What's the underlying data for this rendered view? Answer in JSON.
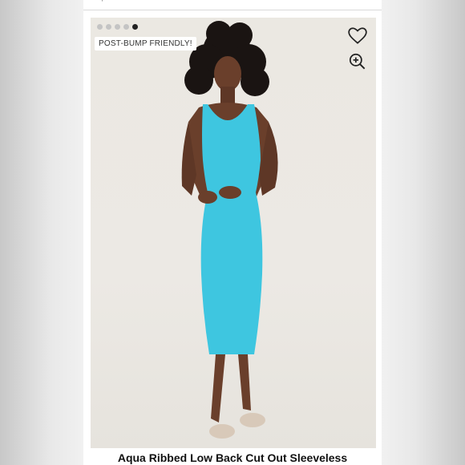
{
  "top_bar": {
    "partial_text": "… , … …"
  },
  "gallery": {
    "dots": [
      false,
      false,
      false,
      false,
      true
    ],
    "badge": "POST-BUMP FRIENDLY!",
    "favorite_icon": "heart-icon",
    "zoom_icon": "zoom-in-icon",
    "dress_color": "#3ec6e0"
  },
  "product": {
    "title": "Aqua Ribbed Low Back Cut Out Sleeveless"
  }
}
